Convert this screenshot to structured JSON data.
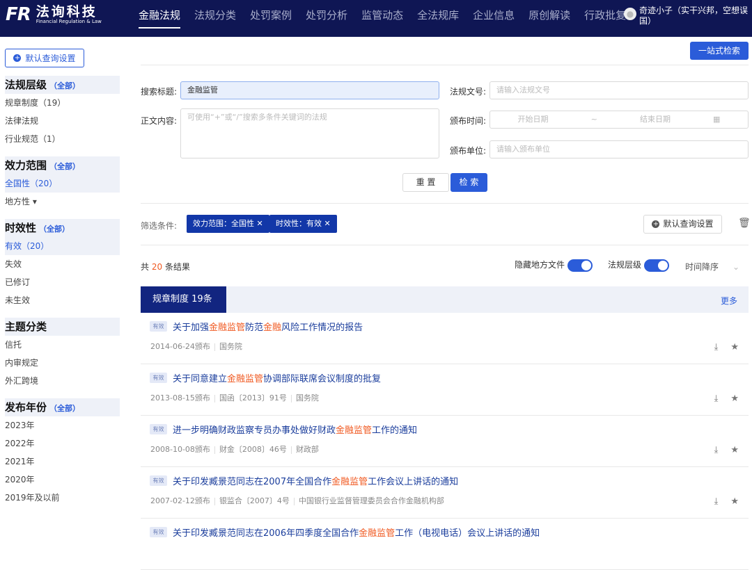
{
  "header": {
    "logo_mark": "FR",
    "logo_cn": "法询科技",
    "logo_en": "Financial Regulation & Law",
    "nav": [
      "金融法规",
      "法规分类",
      "处罚案例",
      "处罚分析",
      "监管动态",
      "全法规库",
      "企业信息",
      "原创解读",
      "行政批复"
    ],
    "active_nav": 0,
    "user": "奇迹小子（实干兴邦，空想误国）"
  },
  "sidebar": {
    "default_btn": "默认查询设置",
    "sections": [
      {
        "title": "法规层级",
        "all": "（全部）",
        "items": [
          "规章制度（19）",
          "法律法规",
          "行业规范（1）"
        ],
        "selected": -1
      },
      {
        "title": "效力范围",
        "all": "（全部）",
        "items": [
          "全国性（20）",
          "地方性 ▾"
        ],
        "selected": 0
      },
      {
        "title": "时效性",
        "all": "（全部）",
        "items": [
          "有效（20）",
          "失效",
          "已修订",
          "未生效"
        ],
        "selected": 0
      },
      {
        "title": "主题分类",
        "all": "",
        "items": [
          "信托",
          "内审规定",
          "外汇跨境"
        ],
        "selected": -1
      },
      {
        "title": "发布年份",
        "all": "（全部）",
        "items": [
          "2023年",
          "2022年",
          "2021年",
          "2020年",
          "2019年及以前"
        ],
        "selected": -1
      }
    ]
  },
  "search": {
    "onestop": "一站式检索",
    "title_label": "搜索标题:",
    "title_value": "金融监管",
    "docno_label": "法规文号:",
    "docno_placeholder": "请输入法规文号",
    "body_label": "正文内容:",
    "body_placeholder": "可使用“+”或“/”搜索多条件关键词的法规",
    "date_label": "颁布时间:",
    "date_start": "开始日期",
    "date_sep": "~",
    "date_end": "结束日期",
    "unit_label": "颁布单位:",
    "unit_placeholder": "请输入颁布单位",
    "reset": "重 置",
    "submit": "检 索"
  },
  "filters": {
    "label": "筛选条件:",
    "tags": [
      "效力范围：全国性 ✕",
      "时效性：有效 ✕"
    ],
    "default_btn": "默认查询设置"
  },
  "results": {
    "prefix": "共",
    "count": "20",
    "suffix": "条结果",
    "toggle1": "隐藏地方文件",
    "toggle1_on": true,
    "toggle2": "法规层级",
    "toggle2_on": true,
    "sort": "时间降序",
    "group_title": "规章制度  19条",
    "more": "更多",
    "items": [
      {
        "badge": "有效",
        "title": [
          {
            "t": "关于加强"
          },
          {
            "t": "金融监管",
            "h": true
          },
          {
            "t": "防范"
          },
          {
            "t": "金融",
            "h": true
          },
          {
            "t": "风险工作情况的报告"
          }
        ],
        "meta": [
          "2014-06-24颁布",
          "国务院"
        ]
      },
      {
        "badge": "有效",
        "title": [
          {
            "t": "关于同意建立"
          },
          {
            "t": "金融监管",
            "h": true
          },
          {
            "t": "协调部际联席会议制度的批复"
          }
        ],
        "meta": [
          "2013-08-15颁布",
          "国函〔2013〕91号",
          "国务院"
        ]
      },
      {
        "badge": "有效",
        "title": [
          {
            "t": "进一步明确财政监察专员办事处做好财政"
          },
          {
            "t": "金融监管",
            "h": true
          },
          {
            "t": "工作的通知"
          }
        ],
        "meta": [
          "2008-10-08颁布",
          "财金〔2008〕46号",
          "财政部"
        ]
      },
      {
        "badge": "有效",
        "title": [
          {
            "t": "关于印发臧景范同志在2007年全国合作"
          },
          {
            "t": "金融监管",
            "h": true
          },
          {
            "t": "工作会议上讲话的通知"
          }
        ],
        "meta": [
          "2007-02-12颁布",
          "银监合〔2007〕4号",
          "中国银行业监督管理委员会合作金融机构部"
        ]
      },
      {
        "badge": "有效",
        "title": [
          {
            "t": "关于印发臧景范同志在2006年四季度全国合作"
          },
          {
            "t": "金融监管",
            "h": true
          },
          {
            "t": "工作（电视电话）会议上讲话的通知"
          }
        ],
        "meta": []
      }
    ]
  },
  "colors": {
    "header_bg": "#0f1654",
    "primary": "#2b5cd9",
    "highlight": "#f05a22",
    "tag_bg": "#1237a8"
  }
}
